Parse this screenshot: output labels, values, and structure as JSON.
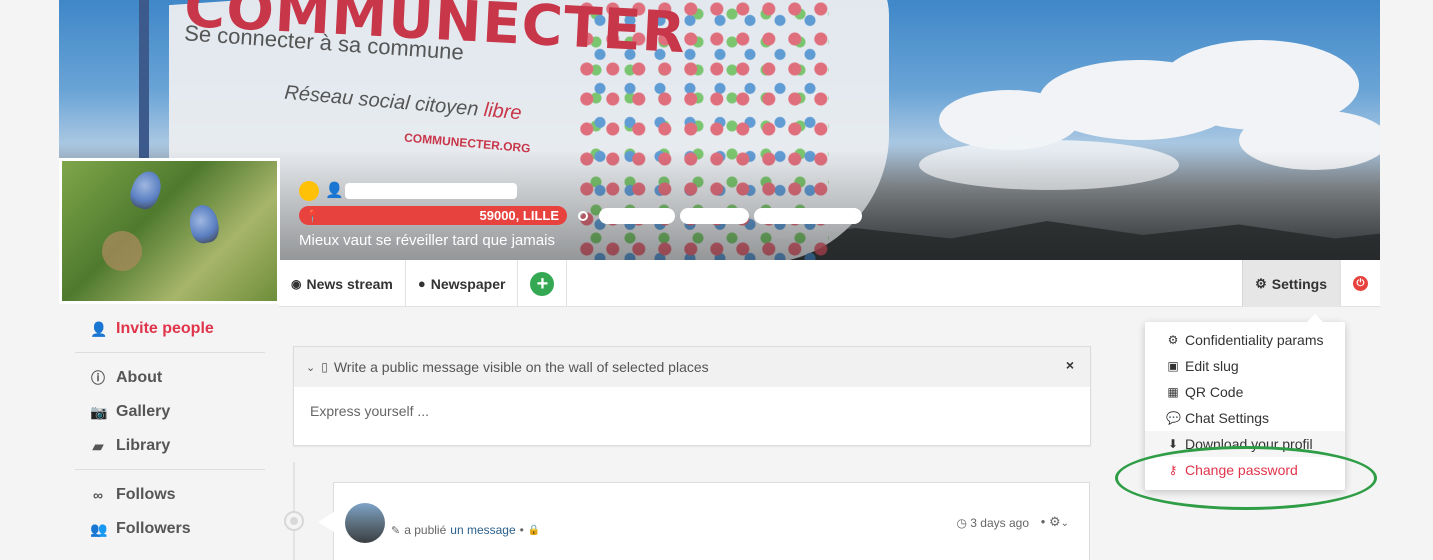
{
  "banner": {
    "flag_title": "COMMUNECTER",
    "flag_subtitle": "Se connecter à sa commune",
    "flag_tagline_prefix": "Réseau social citoyen ",
    "flag_tagline_word": "libre",
    "flag_url": "COMMUNECTER.ORG"
  },
  "profile": {
    "address": "59000, LILLE",
    "slogan": "Mieux vaut se réveiller tard que jamais"
  },
  "nav": {
    "news_stream": "News stream",
    "newspaper": "Newspaper",
    "add": "+",
    "settings": "Settings"
  },
  "sidebar": {
    "invite": "Invite people",
    "items": [
      {
        "label": "About",
        "icon": "info-icon"
      },
      {
        "label": "Gallery",
        "icon": "camera-icon"
      },
      {
        "label": "Library",
        "icon": "book-icon"
      }
    ],
    "items2": [
      {
        "label": "Follows",
        "icon": "link-icon"
      },
      {
        "label": "Followers",
        "icon": "users-icon"
      }
    ]
  },
  "composer": {
    "header": "Write a public message visible on the wall of selected places",
    "close": "×",
    "placeholder": "Express yourself ..."
  },
  "post": {
    "action_prefix": "a publié",
    "action_link": "un message",
    "separator": "•",
    "time": "3 days ago"
  },
  "dropdown": {
    "items": [
      {
        "label": "Confidentiality params",
        "icon": "gears-icon"
      },
      {
        "label": "Edit slug",
        "icon": "id-badge-icon"
      },
      {
        "label": "QR Code",
        "icon": "qrcode-icon"
      },
      {
        "label": "Chat Settings",
        "icon": "comments-icon"
      },
      {
        "label": "Download your profil",
        "icon": "download-icon"
      },
      {
        "label": "Change password",
        "icon": "key-icon"
      }
    ]
  },
  "colors": {
    "accent_red": "#e0344b",
    "address_red": "#e8423f",
    "green": "#34a853",
    "yellow": "#ffc107",
    "highlight_green": "#2e9d45"
  }
}
